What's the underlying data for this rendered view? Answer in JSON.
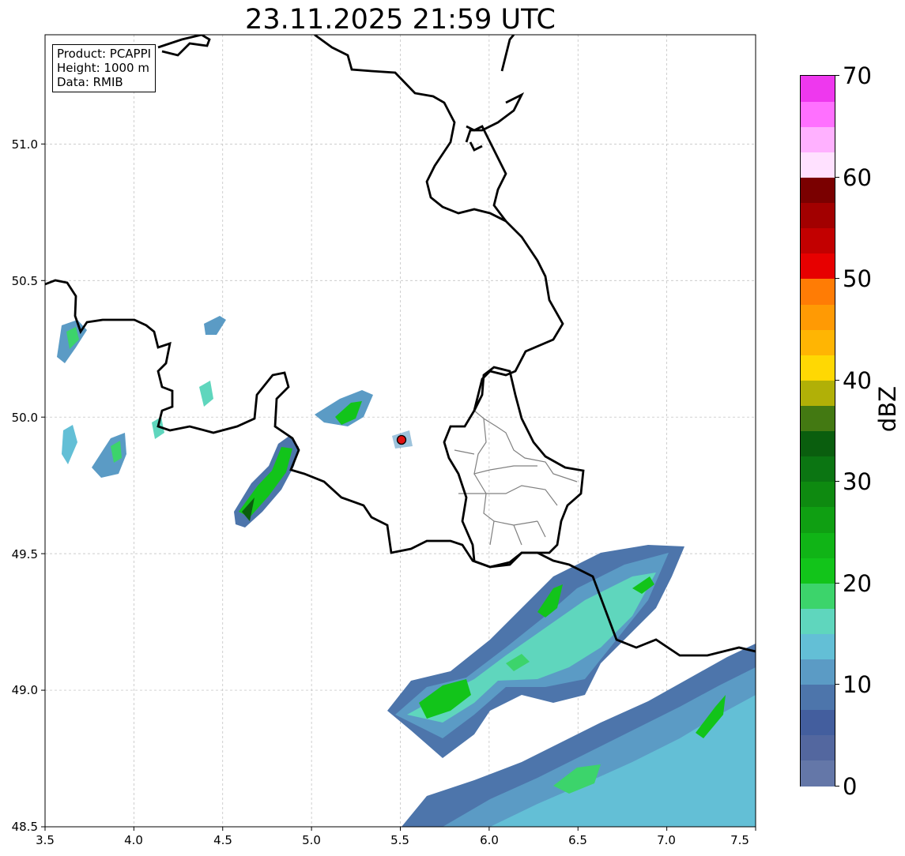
{
  "title": "23.11.2025 21:59 UTC",
  "info": {
    "product": "Product: PCAPPI",
    "height": "Height: 1000 m",
    "data": "Data: RMIB"
  },
  "axes": {
    "x_ticks": [
      "3.5",
      "4.0",
      "4.5",
      "5.0",
      "5.5",
      "6.0",
      "6.5",
      "7.0",
      "7.5"
    ],
    "y_ticks": [
      "48.5",
      "49.0",
      "49.5",
      "50.0",
      "50.5",
      "51.0"
    ],
    "xlim": [
      3.5,
      7.5
    ],
    "ylim": [
      48.5,
      51.4
    ],
    "grid": true
  },
  "radar_site": {
    "lon": 5.505,
    "lat": 49.914,
    "color": "#e01010"
  },
  "colorbar": {
    "label": "dBZ",
    "ticks": [
      "0",
      "10",
      "20",
      "30",
      "40",
      "50",
      "60",
      "70"
    ],
    "range": [
      0,
      70
    ],
    "colors": [
      "#6477a8",
      "#53679f",
      "#435e9e",
      "#4d75ab",
      "#5b9bc5",
      "#63bfd6",
      "#5fd6bd",
      "#3cd46b",
      "#12c41a",
      "#10b416",
      "#0f9f12",
      "#0e8a10",
      "#0b7512",
      "#0a5e0e",
      "#437912",
      "#b1b007",
      "#ffd803",
      "#ffb503",
      "#ff9a04",
      "#ff7c05",
      "#e70000",
      "#c20000",
      "#a20000",
      "#7a0000",
      "#ffe1ff",
      "#ffb1ff",
      "#ff70ff",
      "#ee38ee"
    ]
  },
  "colors": {
    "border": "#000000",
    "district_border": "#808080",
    "grid": "#bbbbbb"
  }
}
